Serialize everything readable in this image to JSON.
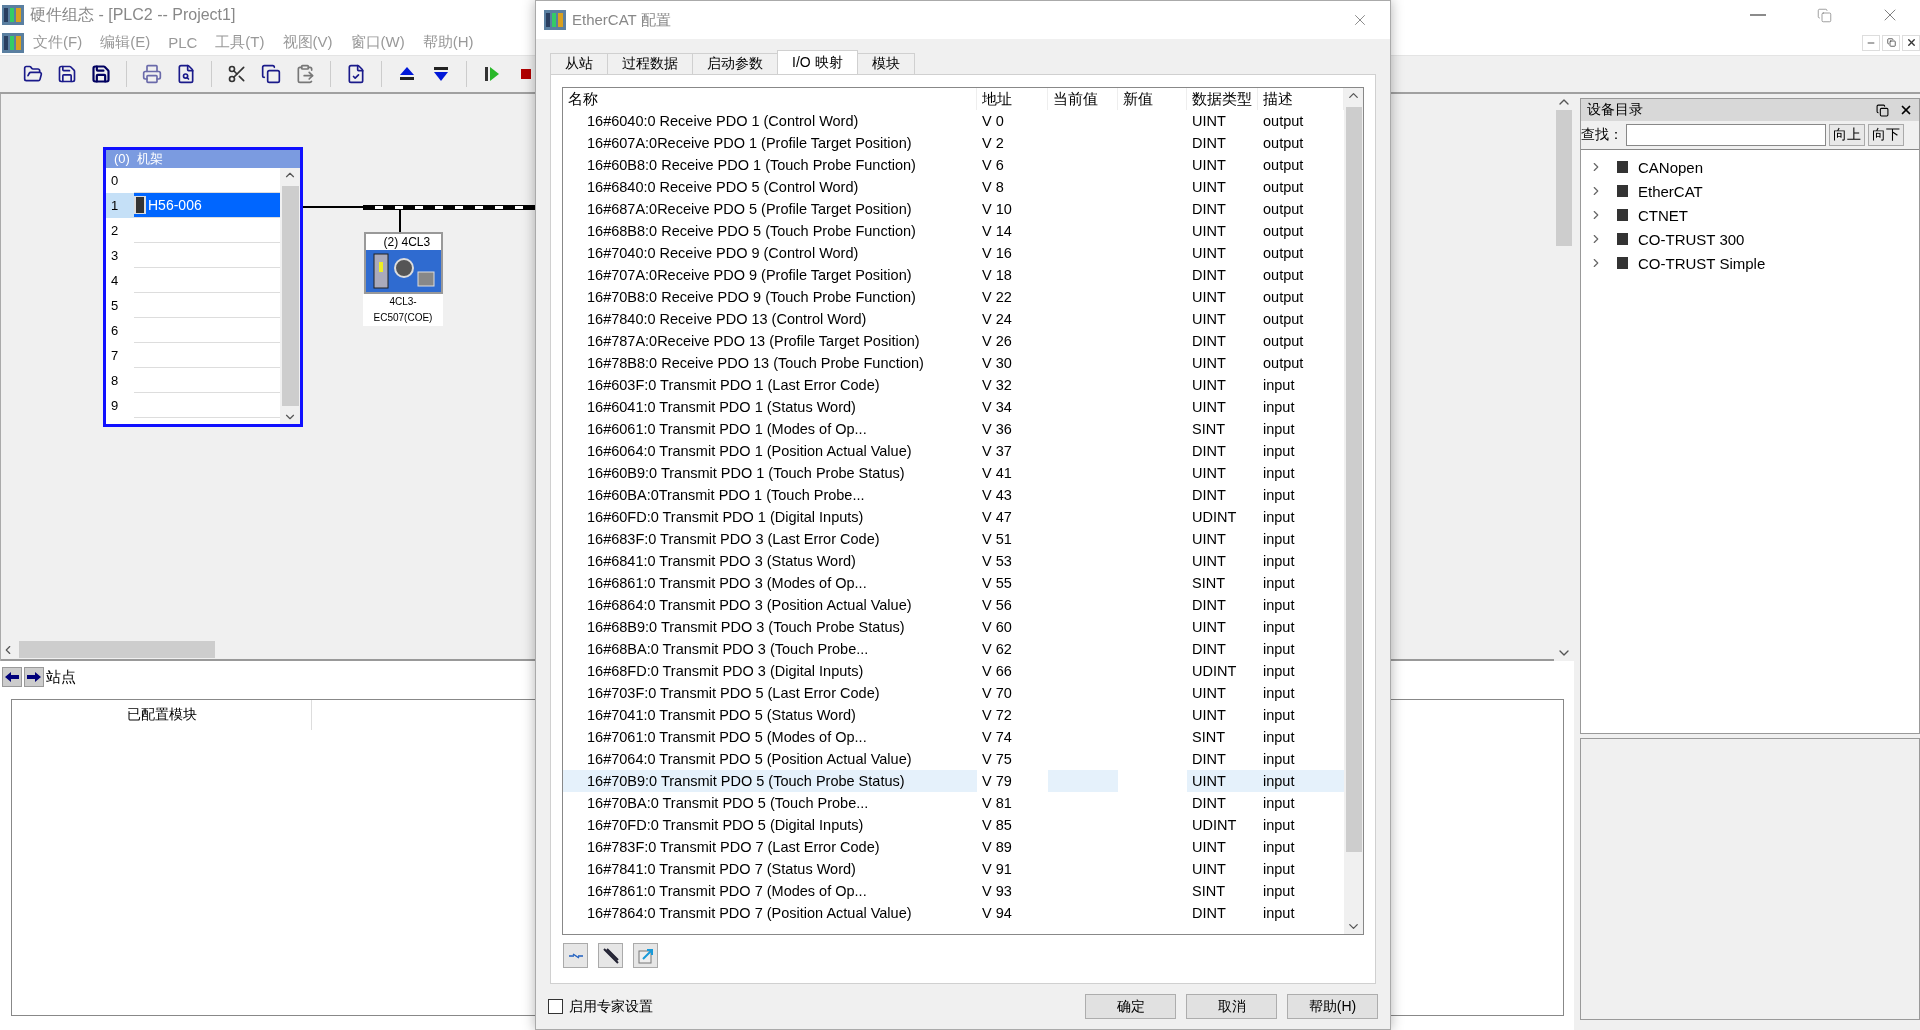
{
  "app": {
    "title": "硬件组态 - [PLC2 -- Project1]"
  },
  "menu": [
    "文件(F)",
    "编辑(E)",
    "PLC",
    "工具(T)",
    "视图(V)",
    "窗口(W)",
    "帮助(H)"
  ],
  "rack": {
    "title": "(0)  机架",
    "slots": [
      {
        "number": "0",
        "selected": false
      },
      {
        "number": "1",
        "module": "H56-006",
        "selected": true
      },
      {
        "number": "2",
        "selected": false
      },
      {
        "number": "3",
        "selected": false
      },
      {
        "number": "4",
        "selected": false
      },
      {
        "number": "5",
        "selected": false
      },
      {
        "number": "6",
        "selected": false
      },
      {
        "number": "7",
        "selected": false
      },
      {
        "number": "8",
        "selected": false
      },
      {
        "number": "9",
        "selected": false
      }
    ]
  },
  "device": {
    "title": "(2) 4CL3",
    "label": [
      "4CL3-",
      "EC507(COE)"
    ]
  },
  "station": {
    "label": "站点"
  },
  "module_table": {
    "columns": [
      "已配置模块"
    ]
  },
  "dialog": {
    "title": "EtherCAT 配置",
    "tabs": [
      {
        "label": "从站",
        "selected": false
      },
      {
        "label": "过程数据",
        "selected": false
      },
      {
        "label": "启动参数",
        "selected": false
      },
      {
        "label": "I/O 映射",
        "selected": true
      },
      {
        "label": "模块",
        "selected": false
      }
    ],
    "columns": [
      "名称",
      "地址",
      "当前值",
      "新值",
      "数据类型",
      "描述"
    ],
    "rows": [
      {
        "name": "16#6040:0 Receive PDO 1 (Control Word)",
        "address": "V 0",
        "type": "UINT",
        "description": "output",
        "selected": false
      },
      {
        "name": "16#607A:0Receive PDO 1 (Profile Target Position)",
        "address": "V 2",
        "type": "DINT",
        "description": "output",
        "selected": false
      },
      {
        "name": "16#60B8:0 Receive PDO 1 (Touch Probe Function)",
        "address": "V 6",
        "type": "UINT",
        "description": "output",
        "selected": false
      },
      {
        "name": "16#6840:0 Receive PDO 5 (Control Word)",
        "address": "V 8",
        "type": "UINT",
        "description": "output",
        "selected": false
      },
      {
        "name": "16#687A:0Receive PDO 5 (Profile Target Position)",
        "address": "V 10",
        "type": "DINT",
        "description": "output",
        "selected": false
      },
      {
        "name": "16#68B8:0 Receive PDO 5 (Touch Probe Function)",
        "address": "V 14",
        "type": "UINT",
        "description": "output",
        "selected": false
      },
      {
        "name": "16#7040:0 Receive PDO 9 (Control Word)",
        "address": "V 16",
        "type": "UINT",
        "description": "output",
        "selected": false
      },
      {
        "name": "16#707A:0Receive PDO 9 (Profile Target Position)",
        "address": "V 18",
        "type": "DINT",
        "description": "output",
        "selected": false
      },
      {
        "name": "16#70B8:0 Receive PDO 9 (Touch Probe Function)",
        "address": "V 22",
        "type": "UINT",
        "description": "output",
        "selected": false
      },
      {
        "name": "16#7840:0 Receive PDO 13 (Control Word)",
        "address": "V 24",
        "type": "UINT",
        "description": "output",
        "selected": false
      },
      {
        "name": "16#787A:0Receive PDO 13 (Profile Target Position)",
        "address": "V 26",
        "type": "DINT",
        "description": "output",
        "selected": false
      },
      {
        "name": "16#78B8:0 Receive PDO 13 (Touch Probe Function)",
        "address": "V 30",
        "type": "UINT",
        "description": "output",
        "selected": false
      },
      {
        "name": "16#603F:0 Transmit PDO 1 (Last Error Code)",
        "address": "V 32",
        "type": "UINT",
        "description": "input",
        "selected": false
      },
      {
        "name": "16#6041:0 Transmit PDO 1 (Status Word)",
        "address": "V 34",
        "type": "UINT",
        "description": "input",
        "selected": false
      },
      {
        "name": "16#6061:0 Transmit PDO 1 (Modes of Op...",
        "address": "V 36",
        "type": "SINT",
        "description": "input",
        "selected": false
      },
      {
        "name": "16#6064:0 Transmit PDO 1 (Position Actual Value)",
        "address": "V 37",
        "type": "DINT",
        "description": "input",
        "selected": false
      },
      {
        "name": "16#60B9:0 Transmit PDO 1 (Touch Probe Status)",
        "address": "V 41",
        "type": "UINT",
        "description": "input",
        "selected": false
      },
      {
        "name": "16#60BA:0Transmit PDO 1 (Touch Probe...",
        "address": "V 43",
        "type": "DINT",
        "description": "input",
        "selected": false
      },
      {
        "name": "16#60FD:0 Transmit PDO 1 (Digital Inputs)",
        "address": "V 47",
        "type": "UDINT",
        "description": "input",
        "selected": false
      },
      {
        "name": "16#683F:0 Transmit PDO 3 (Last Error Code)",
        "address": "V 51",
        "type": "UINT",
        "description": "input",
        "selected": false
      },
      {
        "name": "16#6841:0 Transmit PDO 3 (Status Word)",
        "address": "V 53",
        "type": "UINT",
        "description": "input",
        "selected": false
      },
      {
        "name": "16#6861:0 Transmit PDO 3 (Modes of Op...",
        "address": "V 55",
        "type": "SINT",
        "description": "input",
        "selected": false
      },
      {
        "name": "16#6864:0 Transmit PDO 3 (Position Actual Value)",
        "address": "V 56",
        "type": "DINT",
        "description": "input",
        "selected": false
      },
      {
        "name": "16#68B9:0 Transmit PDO 3 (Touch Probe Status)",
        "address": "V 60",
        "type": "UINT",
        "description": "input",
        "selected": false
      },
      {
        "name": "16#68BA:0 Transmit PDO 3 (Touch Probe...",
        "address": "V 62",
        "type": "DINT",
        "description": "input",
        "selected": false
      },
      {
        "name": "16#68FD:0 Transmit PDO 3 (Digital Inputs)",
        "address": "V 66",
        "type": "UDINT",
        "description": "input",
        "selected": false
      },
      {
        "name": "16#703F:0 Transmit PDO 5 (Last Error Code)",
        "address": "V 70",
        "type": "UINT",
        "description": "input",
        "selected": false
      },
      {
        "name": "16#7041:0 Transmit PDO 5 (Status Word)",
        "address": "V 72",
        "type": "UINT",
        "description": "input",
        "selected": false
      },
      {
        "name": "16#7061:0 Transmit PDO 5 (Modes of Op...",
        "address": "V 74",
        "type": "SINT",
        "description": "input",
        "selected": false
      },
      {
        "name": "16#7064:0 Transmit PDO 5 (Position Actual Value)",
        "address": "V 75",
        "type": "DINT",
        "description": "input",
        "selected": false
      },
      {
        "name": "16#70B9:0 Transmit PDO 5 (Touch Probe Status)",
        "address": "V 79",
        "type": "UINT",
        "description": "input",
        "selected": true
      },
      {
        "name": "16#70BA:0 Transmit PDO 5 (Touch Probe...",
        "address": "V 81",
        "type": "DINT",
        "description": "input",
        "selected": false
      },
      {
        "name": "16#70FD:0 Transmit PDO 5 (Digital Inputs)",
        "address": "V 85",
        "type": "UDINT",
        "description": "input",
        "selected": false
      },
      {
        "name": "16#783F:0 Transmit PDO 7 (Last Error Code)",
        "address": "V 89",
        "type": "UINT",
        "description": "input",
        "selected": false
      },
      {
        "name": "16#7841:0 Transmit PDO 7 (Status Word)",
        "address": "V 91",
        "type": "UINT",
        "description": "input",
        "selected": false
      },
      {
        "name": "16#7861:0 Transmit PDO 7 (Modes of Op...",
        "address": "V 93",
        "type": "SINT",
        "description": "input",
        "selected": false
      },
      {
        "name": "16#7864:0 Transmit PDO 7 (Position Actual Value)",
        "address": "V 94",
        "type": "DINT",
        "description": "input",
        "selected": false
      }
    ],
    "expert_settings": {
      "label": "启用专家设置",
      "checked": false
    },
    "buttons": [
      "确定",
      "取消",
      "帮助(H)"
    ]
  },
  "catalog": {
    "title": "设备目录",
    "search_label": "查找：",
    "buttons": [
      "向上",
      "向下"
    ],
    "items": [
      {
        "label": "CANopen",
        "expanded": false
      },
      {
        "label": "EtherCAT",
        "expanded": false
      },
      {
        "label": "CTNET",
        "expanded": false
      },
      {
        "label": "CO-TRUST 300",
        "expanded": false
      },
      {
        "label": "CO-TRUST Simple",
        "expanded": false
      }
    ]
  }
}
